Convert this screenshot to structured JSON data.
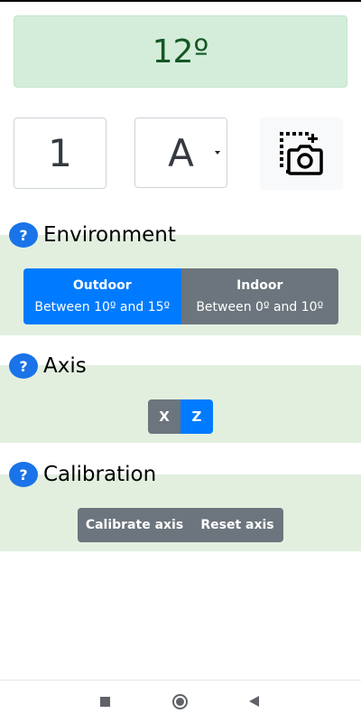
{
  "display": {
    "angle": "12º"
  },
  "controls": {
    "number": "1",
    "letter": "A",
    "camera_icon": "camera-capture-icon"
  },
  "environment": {
    "title": "Environment",
    "help": "?",
    "options": [
      {
        "title": "Outdoor",
        "range": "Between 10º and 15º",
        "selected": true
      },
      {
        "title": "Indoor",
        "range": "Between 0º and 10º",
        "selected": false
      }
    ]
  },
  "axis": {
    "title": "Axis",
    "help": "?",
    "options": [
      {
        "label": "X",
        "selected": false
      },
      {
        "label": "Z",
        "selected": true
      }
    ]
  },
  "calibration": {
    "title": "Calibration",
    "help": "?",
    "buttons": [
      "Calibrate axis",
      "Reset axis"
    ]
  },
  "colors": {
    "primary": "#007bff",
    "secondary": "#6c757d",
    "success_bg": "#d4edda",
    "success_text": "#155724",
    "section_bg": "#e2efdf"
  },
  "navbar": {
    "icons": [
      "recent-apps-icon",
      "home-icon",
      "back-icon"
    ]
  }
}
